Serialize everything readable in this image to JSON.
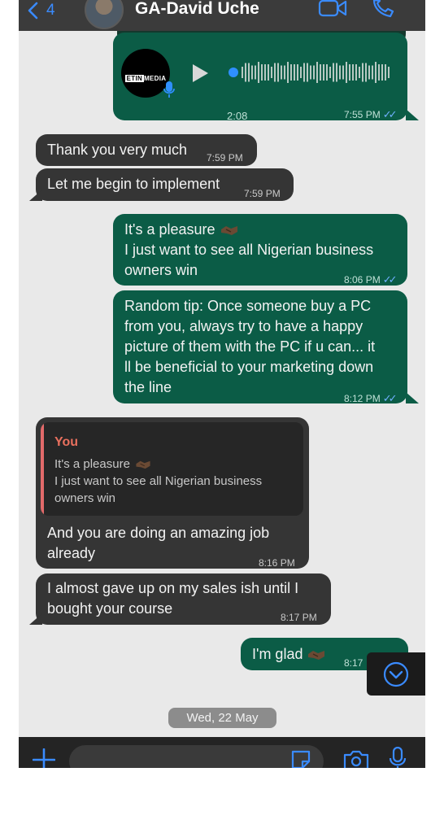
{
  "header": {
    "back_count": "4",
    "contact_name": "GA-David Uche"
  },
  "voice_note": {
    "thumbnail_text_a": "ETIN",
    "thumbnail_text_b": "MEDIA",
    "duration": "2:08",
    "time": "7:55 PM",
    "tick": "✓✓"
  },
  "messages": [
    {
      "text": "Thank you very much",
      "time": "7:59 PM"
    },
    {
      "text": "Let me begin to implement",
      "time": "7:59 PM"
    },
    {
      "line1": "It's a pleasure",
      "line2": "I just want to see all Nigerian business",
      "line3": "owners win",
      "time": "8:06 PM",
      "tick": "✓✓"
    },
    {
      "line1": "Random tip: Once someone buy a PC",
      "line2": "from you, always try to have a happy",
      "line3": "picture of them with the PC if u can... it",
      "line4": "ll be beneficial to your marketing down",
      "line5": "the line",
      "time": "8:12 PM",
      "tick": "✓✓"
    },
    {
      "quote_author": "You",
      "quote_line1": "It's a pleasure",
      "quote_line2": "I just want to see all Nigerian business",
      "quote_line3": "owners win",
      "line1": "And you are doing an amazing job",
      "line2": "already",
      "time": "8:16 PM"
    },
    {
      "line1": "I almost gave up on my sales ish until I",
      "line2": "bought your course",
      "time": "8:17 PM"
    },
    {
      "text": "I'm glad",
      "time": "8:17"
    }
  ],
  "date_separator": "Wed, 22 May",
  "input": {
    "placeholder": ""
  },
  "colors": {
    "accent": "#3a8bff",
    "outgoing_bubble": "#0b5c46",
    "incoming_bubble": "#353535",
    "quote_author": "#e8705e"
  },
  "icons": [
    "chevron-left-icon",
    "video-camera-icon",
    "phone-icon",
    "play-icon",
    "microphone-icon",
    "chevron-down-icon",
    "plus-icon",
    "sticker-icon",
    "camera-icon",
    "handshake-emoji-icon"
  ]
}
